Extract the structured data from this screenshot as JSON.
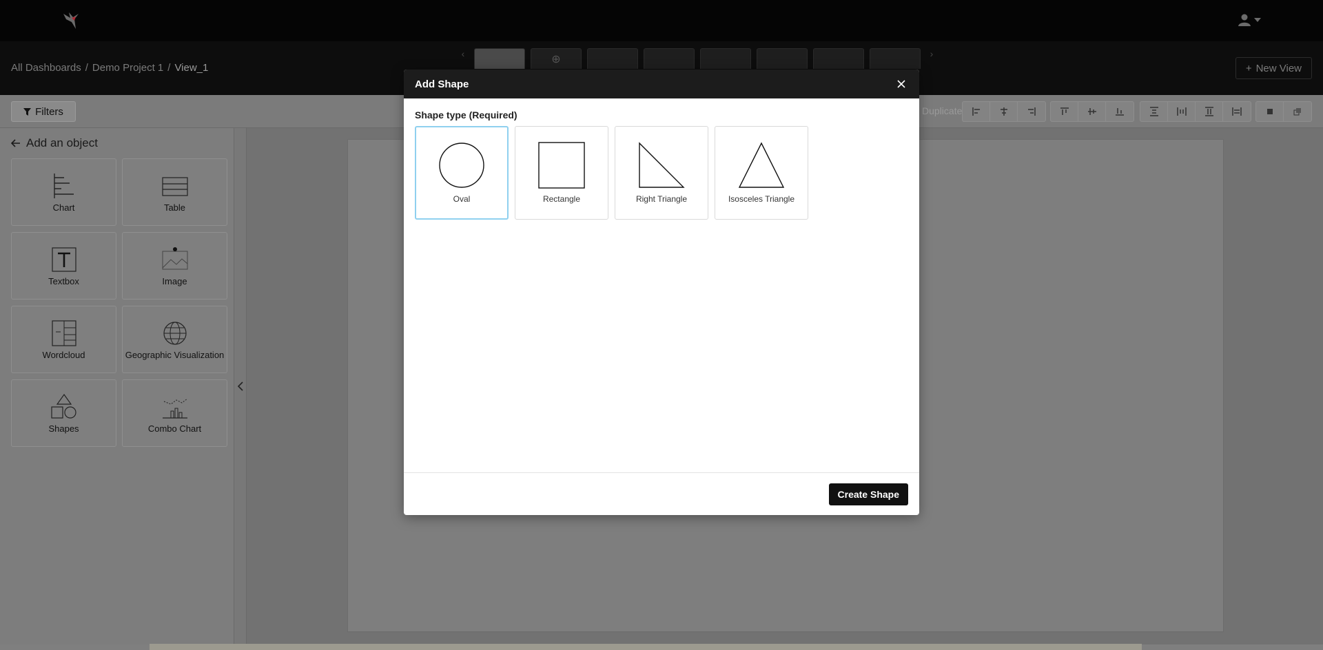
{
  "breadcrumb": {
    "root": "All Dashboards",
    "project": "Demo Project 1",
    "view": "View_1",
    "separator": "/"
  },
  "header": {
    "new_view_label": "New View",
    "new_view_icon": "plus-icon",
    "user_icon": "user-icon"
  },
  "toolbar": {
    "filters_label": "Filters",
    "duplicate_label": "Duplicate"
  },
  "sidebar": {
    "title": "Add an object",
    "objects": [
      {
        "label": "Chart",
        "icon": "chart-icon"
      },
      {
        "label": "Table",
        "icon": "table-icon"
      },
      {
        "label": "Textbox",
        "icon": "textbox-icon"
      },
      {
        "label": "Image",
        "icon": "image-icon"
      },
      {
        "label": "Wordcloud",
        "icon": "wordcloud-icon"
      },
      {
        "label": "Geographic Visualization",
        "icon": "globe-icon"
      },
      {
        "label": "Shapes",
        "icon": "shapes-icon"
      },
      {
        "label": "Combo Chart",
        "icon": "combo-chart-icon"
      }
    ]
  },
  "modal": {
    "title": "Add Shape",
    "field_label": "Shape type (Required)",
    "shapes": [
      {
        "label": "Oval",
        "icon": "oval-icon",
        "selected": true
      },
      {
        "label": "Rectangle",
        "icon": "rectangle-icon",
        "selected": false
      },
      {
        "label": "Right Triangle",
        "icon": "right-triangle-icon",
        "selected": false
      },
      {
        "label": "Isosceles Triangle",
        "icon": "isosceles-triangle-icon",
        "selected": false
      }
    ],
    "submit_label": "Create Shape"
  },
  "colors": {
    "selection_border": "#8fd0ef",
    "header_bg": "#1c1c1c",
    "primary_button": "#111111",
    "brand_red": "#c0303a"
  }
}
